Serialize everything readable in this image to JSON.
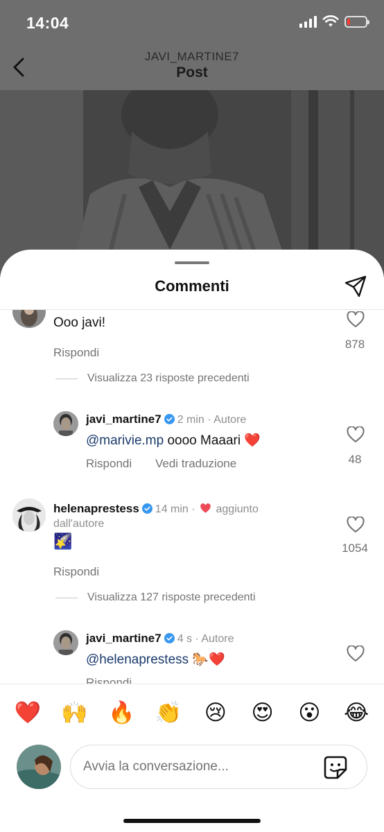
{
  "status_bar": {
    "time": "14:04"
  },
  "header": {
    "username": "JAVI_MARTINE7",
    "title": "Post"
  },
  "sheet": {
    "title": "Commenti"
  },
  "comments": [
    {
      "text": "Ooo javi!",
      "reply_label": "Rispondi",
      "likes": "878"
    },
    {
      "view_replies": "Visualizza 23 risposte precedenti"
    },
    {
      "username": "javi_martine7",
      "meta": "2 min · Autore",
      "mention": "@marivie.mp",
      "text": " oooo Maaari ❤️",
      "reply_label": "Rispondi",
      "translate_label": "Vedi traduzione",
      "likes": "48"
    },
    {
      "username": "helenaprestess",
      "meta_time": "14 min ·",
      "meta_liked": "aggiunto",
      "meta_liked_2": "dall'autore",
      "emoji": "🌠",
      "reply_label": "Rispondi",
      "likes": "1054"
    },
    {
      "view_replies": "Visualizza 127 risposte precedenti"
    },
    {
      "username": "javi_martine7",
      "meta": "4 s · Autore",
      "mention": "@helenaprestess",
      "text": " 🐎❤️",
      "reply_label": "Rispondi"
    }
  ],
  "reactions": [
    "❤️",
    "🙌",
    "🔥",
    "👏",
    "😢",
    "😍",
    "😮",
    "😂"
  ],
  "composer": {
    "placeholder": "Avvia la conversazione..."
  },
  "icons": {
    "back": "chevron-left-icon",
    "send": "paper-plane-icon",
    "like": "heart-outline-icon",
    "verified": "verified-badge-icon",
    "sticker": "sticker-icon",
    "liked_by_author": "red-heart-icon"
  },
  "colors": {
    "verified": "#3897f0",
    "heart_red": "#ed4956",
    "mention": "#1a3a6b",
    "dim_overlay": "#6e6e6e"
  }
}
